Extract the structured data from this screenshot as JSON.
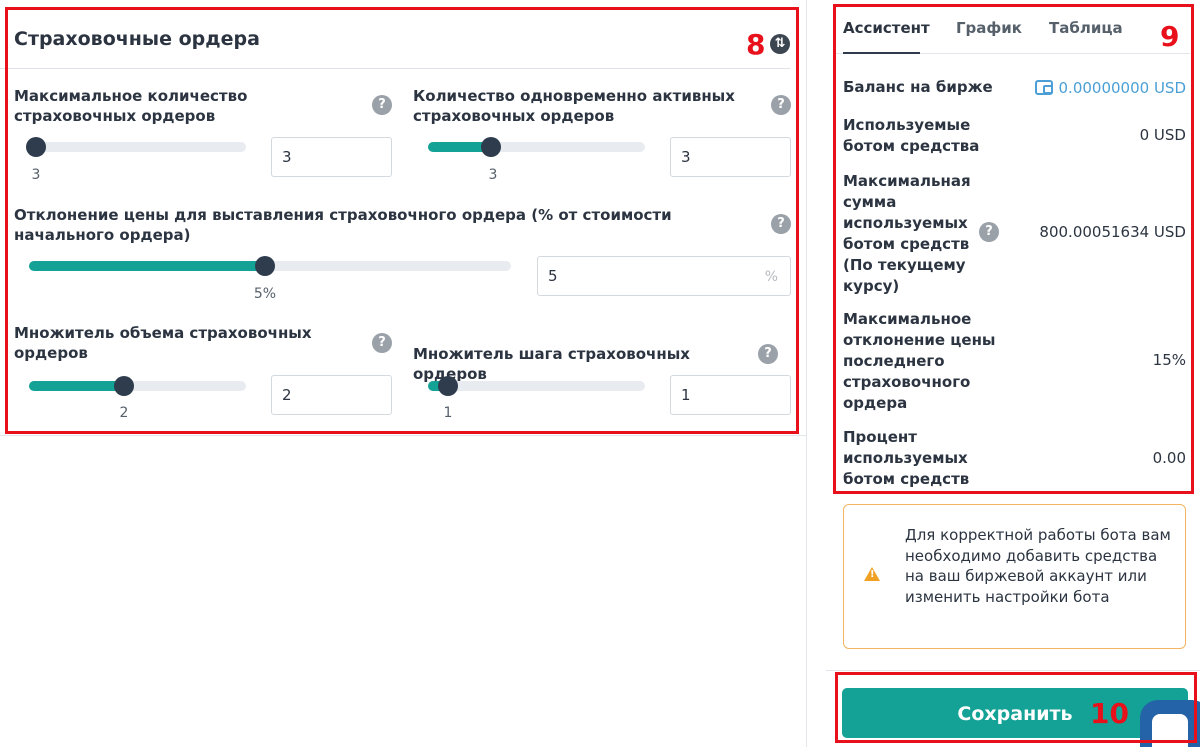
{
  "safety": {
    "title": "Страховочные ордера",
    "max_orders": {
      "label": "Максимальное количество страховочных ордеров",
      "value": "3",
      "tick": "3",
      "fraction": 0.0
    },
    "active_orders": {
      "label": "Количество одновременно активных страховочных ордеров",
      "value": "3",
      "tick": "3",
      "fraction": 0.29
    },
    "deviation": {
      "label": "Отклонение цены для выставления страховочного ордера (% от стоимости начального ордера)",
      "value": "5",
      "unit": "%",
      "tick": "5%",
      "fraction": 0.49
    },
    "volume_mult": {
      "label": "Множитель объема страховочных ордеров",
      "value": "2",
      "tick": "2",
      "fraction": 0.44
    },
    "step_mult": {
      "label": "Множитель шага страховочных ордеров",
      "value": "1",
      "tick": "1",
      "fraction": 0.09
    }
  },
  "tabs": [
    {
      "label": "Ассистент",
      "active": true
    },
    {
      "label": "График",
      "active": false
    },
    {
      "label": "Таблица",
      "active": false
    }
  ],
  "assistant": {
    "balance_label": "Баланс на бирже",
    "balance_value": "0.00000000 USD",
    "used_label": "Используемые ботом средства",
    "used_value": "0 USD",
    "max_sum_label": "Максимальная сумма используемых ботом средств (По текущему курсу)",
    "max_sum_value": "800.00051634 USD",
    "max_dev_label": "Максимальное отклонение цены последнего страховочного ордера",
    "max_dev_value": "15%",
    "percent_label": "Процент используемых ботом средств",
    "percent_value": "0.00"
  },
  "warning": {
    "text": "Для корректной работы бота вам необходимо добавить средства на ваш биржевой аккаунт или изменить настройки бота"
  },
  "save_label": "Сохранить",
  "annotations": {
    "n8": "8",
    "n9": "9",
    "n10": "10"
  },
  "colors": {
    "accent": "#13a295",
    "thumb": "#2f3c4e",
    "annotation": "#e8101a",
    "warning": "#f0a123",
    "link": "#4b9fd6"
  }
}
